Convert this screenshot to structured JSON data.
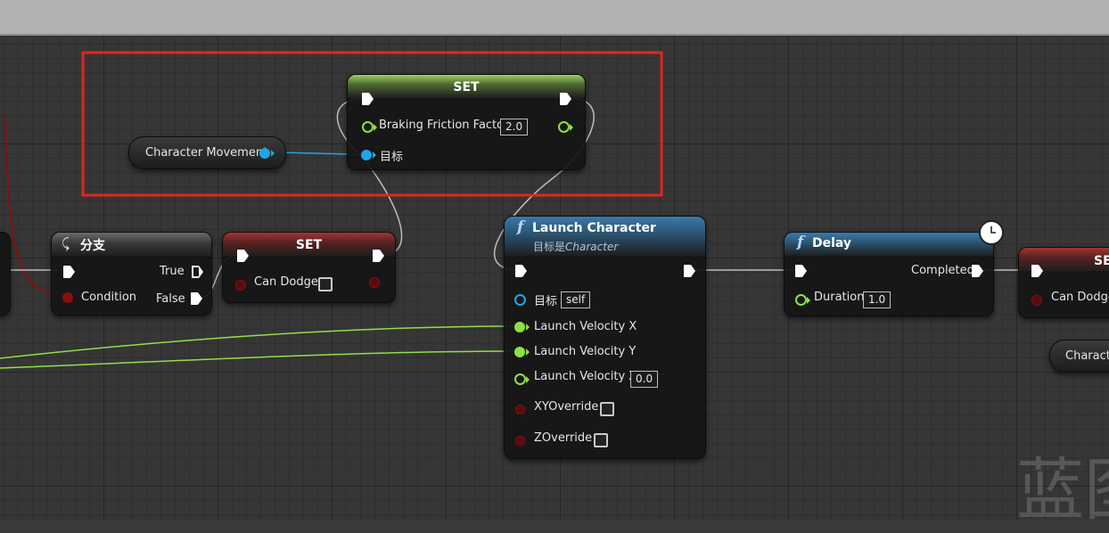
{
  "nodes": {
    "set_braking": {
      "title": "SET",
      "pin_braking": "Braking Friction Factor",
      "braking_value": "2.0",
      "pin_target": "目标"
    },
    "char_movement": {
      "label": "Character Movement"
    },
    "branch": {
      "title": "分支",
      "true_label": "True",
      "false_label": "False",
      "condition_label": "Condition"
    },
    "set_can_dodge": {
      "title": "SET",
      "pin_label": "Can Dodge"
    },
    "launch": {
      "func_icon": "f",
      "title": "Launch Character",
      "subtitle_prefix": "目标是",
      "subtitle_class": "Character",
      "target_label": "目标",
      "target_value": "self",
      "vel_x": "Launch Velocity X",
      "vel_y": "Launch Velocity Y",
      "vel_z": "Launch Velocity Z",
      "vel_z_value": "0.0",
      "xy_override": "XYOverride",
      "z_override": "ZOverride"
    },
    "delay": {
      "func_icon": "f",
      "title": "Delay",
      "completed_label": "Completed",
      "duration_label": "Duration",
      "duration_value": "1.0",
      "clock_icon": "clock-icon"
    },
    "set_right": {
      "title": "SE",
      "pin_label": "Can Dodge"
    },
    "char_right": {
      "label": "Characte"
    }
  },
  "watermark": "蓝图",
  "colors": {
    "highlight_box": "#e3261f",
    "object_pin": "#1fa6e6",
    "float_pin": "#8ee047",
    "bool_pin": "#8b0e0e",
    "exec_wire": "#d0d0d0"
  }
}
